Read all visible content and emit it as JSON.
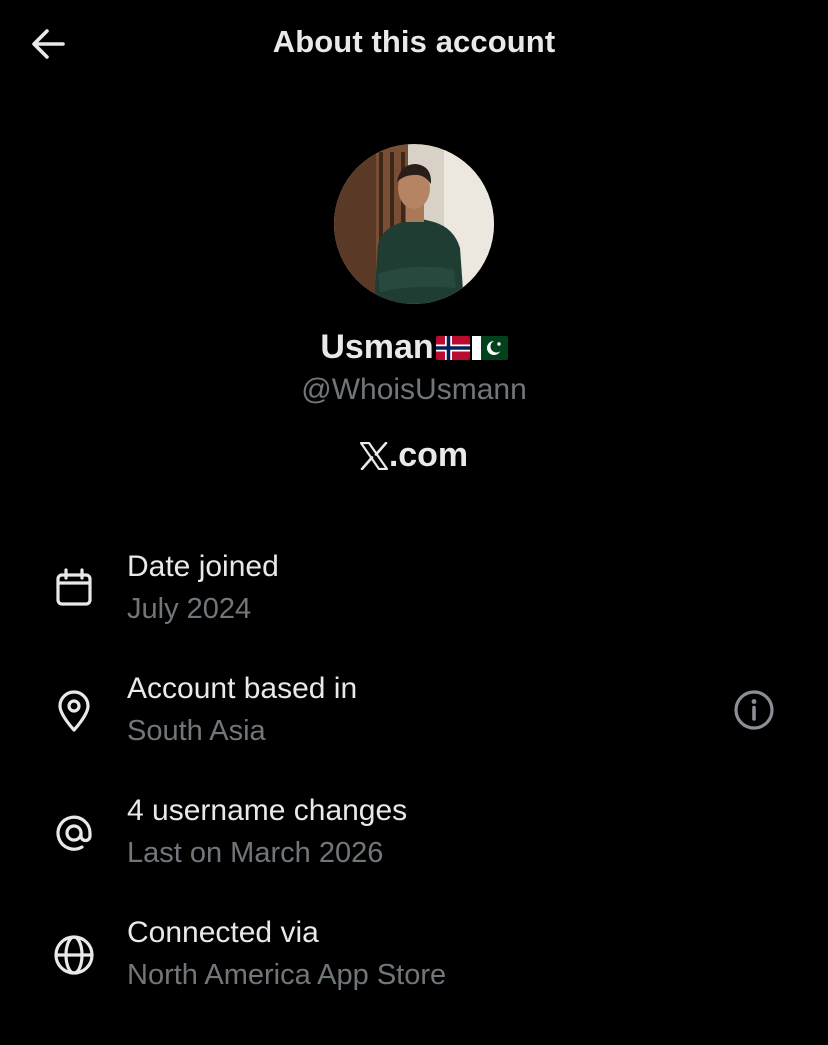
{
  "header": {
    "title": "About this account",
    "back_icon": "arrow-left-icon"
  },
  "profile": {
    "display_name": "Usman",
    "flags": [
      "flag-norway-icon",
      "flag-pakistan-icon"
    ],
    "handle": "@WhoisUsmann",
    "source": ".com",
    "source_icon": "x-logo-icon"
  },
  "details": [
    {
      "icon": "calendar-icon",
      "label": "Date joined",
      "value": "July 2024"
    },
    {
      "icon": "location-pin-icon",
      "label": "Account based in",
      "value": "South Asia",
      "trailing_icon": "info-icon"
    },
    {
      "icon": "at-sign-icon",
      "label": "4 username changes",
      "value": "Last on March 2026"
    },
    {
      "icon": "globe-icon",
      "label": "Connected via",
      "value": "North America App Store"
    }
  ],
  "colors": {
    "background": "#000000",
    "primary_text": "#e7e9ea",
    "secondary_text": "#71767b"
  }
}
